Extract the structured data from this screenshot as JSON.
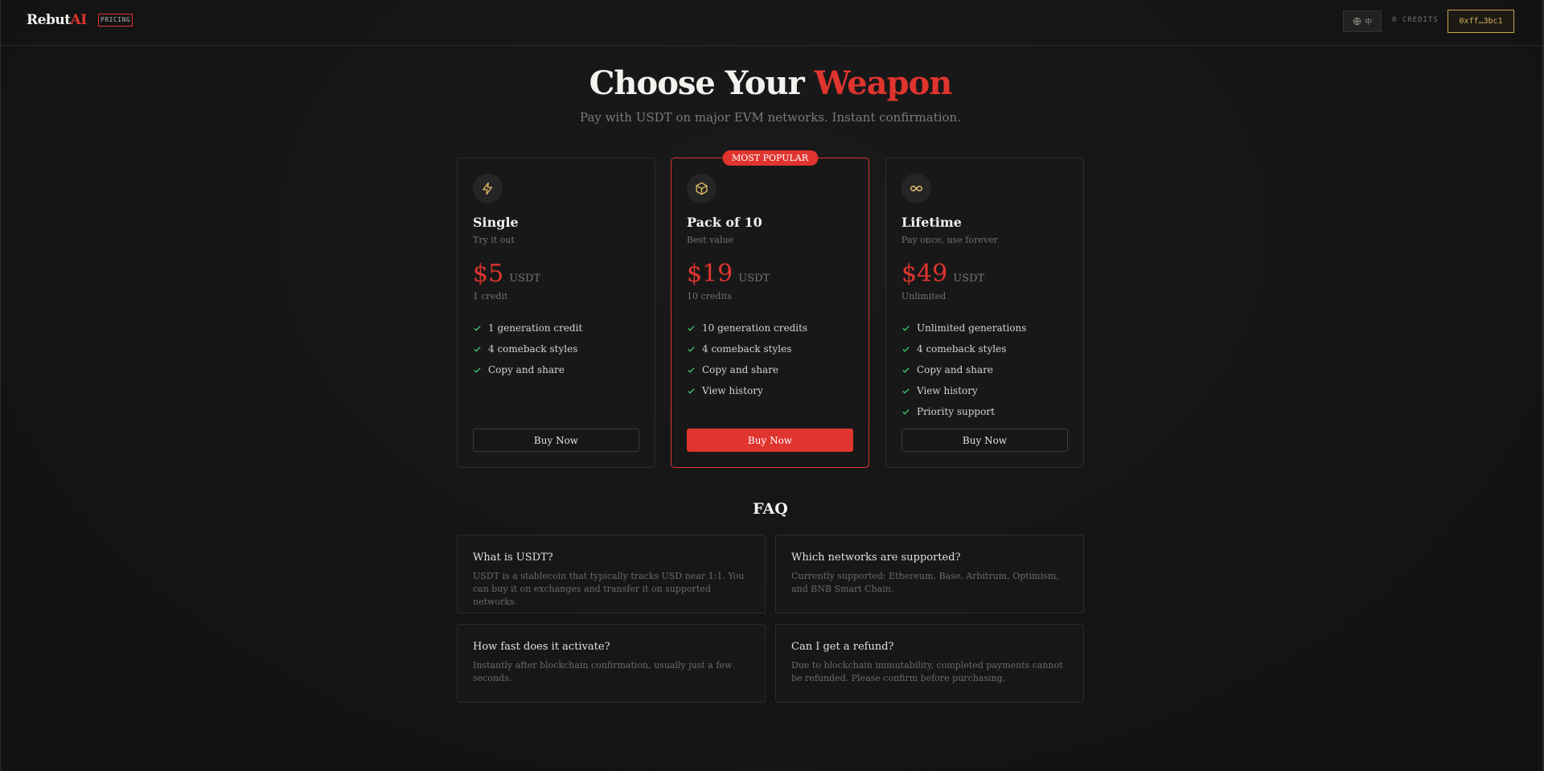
{
  "nav": {
    "logo_main": "Rebut",
    "logo_accent": "AI",
    "page_badge": "PRICING",
    "lang_label": "中",
    "credits_label": "0 CREDITS",
    "wallet_address": "0xff…3bc1"
  },
  "hero": {
    "title_main": "Choose Your",
    "title_accent": "Weapon",
    "subtitle": "Pay with USDT on major EVM networks. Instant confirmation."
  },
  "plans": [
    {
      "icon": "lightning-icon",
      "name": "Single",
      "tagline": "Try it out",
      "price": "$5",
      "currency": "USDT",
      "note": "1 credit",
      "features": [
        "1 generation credit",
        "4 comeback styles",
        "Copy and share"
      ],
      "button": "Buy Now"
    },
    {
      "icon": "package-icon",
      "badge": "MOST POPULAR",
      "name": "Pack of 10",
      "tagline": "Best value",
      "price": "$19",
      "currency": "USDT",
      "note": "10 credits",
      "features": [
        "10 generation credits",
        "4 comeback styles",
        "Copy and share",
        "View history"
      ],
      "button": "Buy Now"
    },
    {
      "icon": "infinity-icon",
      "name": "Lifetime",
      "tagline": "Pay once, use forever",
      "price": "$49",
      "currency": "USDT",
      "note": "Unlimited",
      "features": [
        "Unlimited generations",
        "4 comeback styles",
        "Copy and share",
        "View history",
        "Priority support"
      ],
      "button": "Buy Now"
    }
  ],
  "faq": {
    "title": "FAQ",
    "items": [
      {
        "q": "What is USDT?",
        "a": "USDT is a stablecoin that typically tracks USD near 1:1. You can buy it on exchanges and transfer it on supported networks."
      },
      {
        "q": "Which networks are supported?",
        "a": "Currently supported: Ethereum, Base, Arbitrum, Optimism, and BNB Smart Chain."
      },
      {
        "q": "How fast does it activate?",
        "a": "Instantly after blockchain confirmation, usually just a few seconds."
      },
      {
        "q": "Can I get a refund?",
        "a": "Due to blockchain immutability, completed payments cannot be refunded. Please confirm before purchasing."
      }
    ]
  },
  "colors": {
    "accent": "#e0342f",
    "gold": "#d9b564",
    "check": "#3fbf6a",
    "background": "#141414"
  }
}
